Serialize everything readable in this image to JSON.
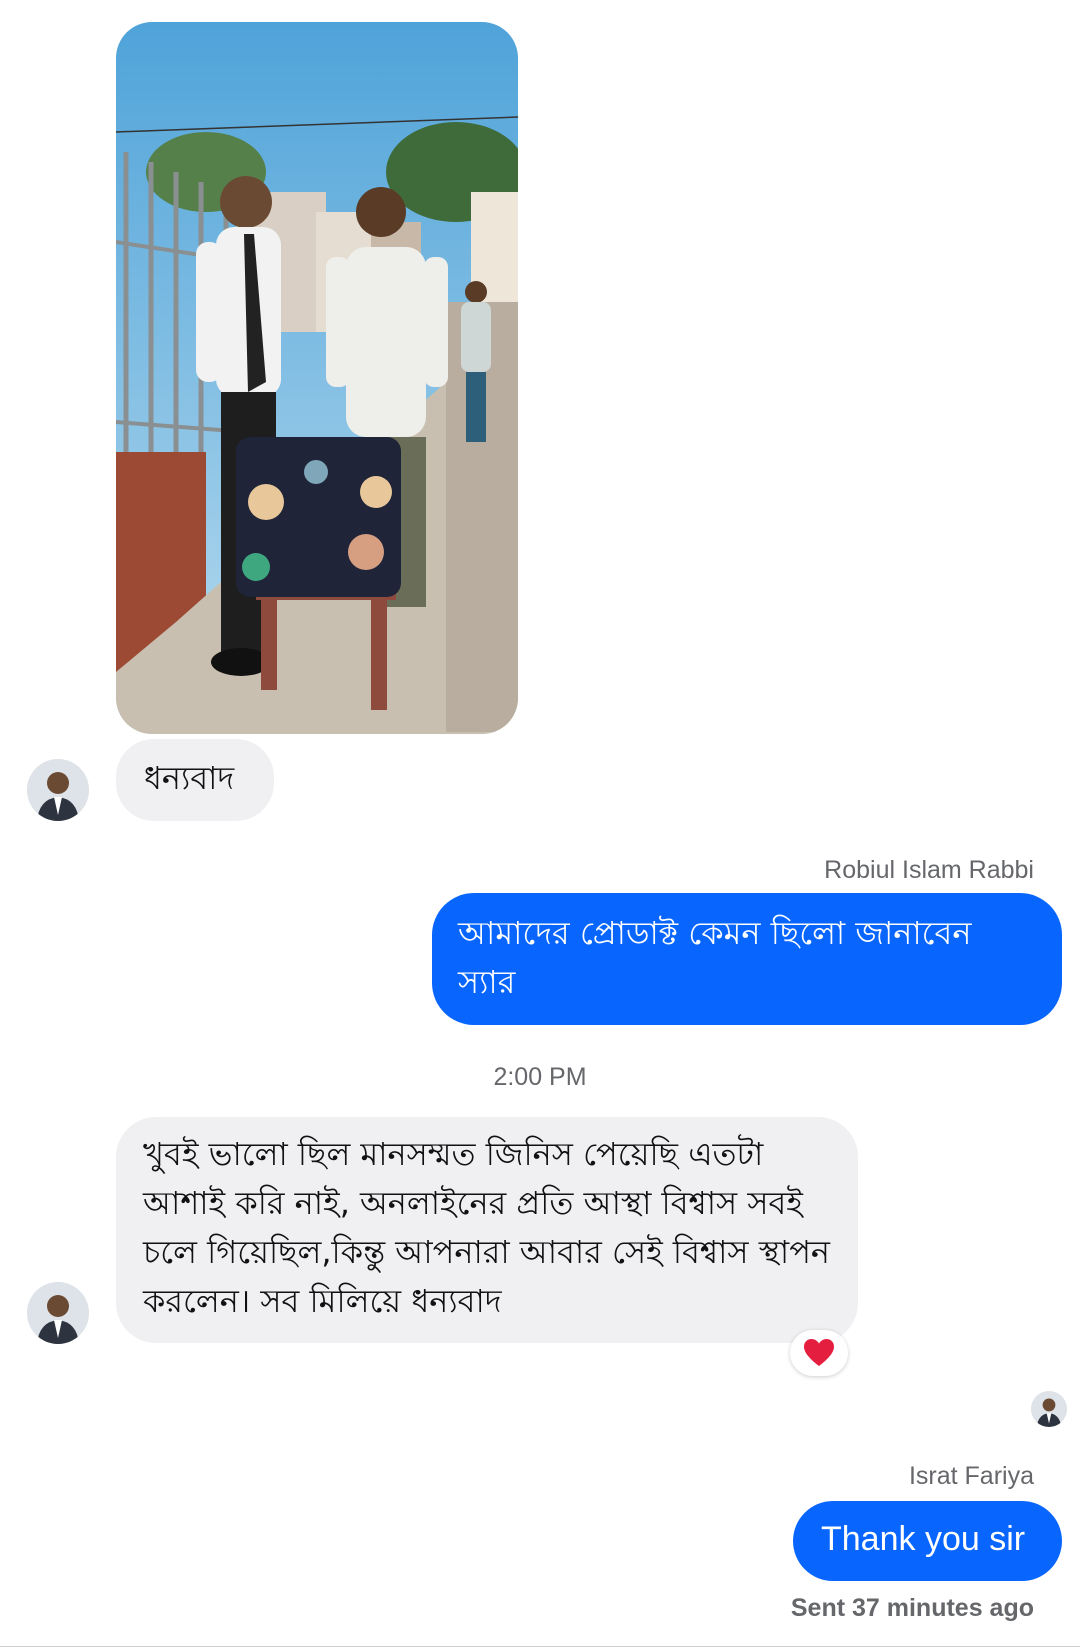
{
  "thread": {
    "photo": {
      "icon": "shared-photo"
    },
    "messages": [
      {
        "direction": "incoming",
        "text": "ধন্যবাদ"
      },
      {
        "direction": "outgoing",
        "sender": "Robiul Islam Rabbi",
        "text": "আমাদের প্রোডাক্ট কেমন ছিলো জানাবেন স্যার"
      },
      {
        "direction": "incoming",
        "text": "খুবই ভালো ছিল মানসম্মত জিনিস পেয়েছি এতটা আশাই করি নাই, অনলাইনের প্রতি আস্থা বিশ্বাস সবই চলে গিয়েছিল,কিন্তু আপনারা আবার সেই বিশ্বাস স্থাপন করলেন। সব মিলিয়ে ধন্যবাদ",
        "reaction": "heart-icon"
      },
      {
        "direction": "outgoing",
        "sender": "Israt Fariya",
        "text": "Thank you sir"
      }
    ],
    "timestamp": "2:00 PM",
    "status": "Sent 37 minutes ago"
  },
  "colors": {
    "outgoing_bubble": "#0866ff",
    "incoming_bubble": "#f0f0f2",
    "meta_text": "#65676b",
    "reaction_heart": "#e41e3f"
  }
}
